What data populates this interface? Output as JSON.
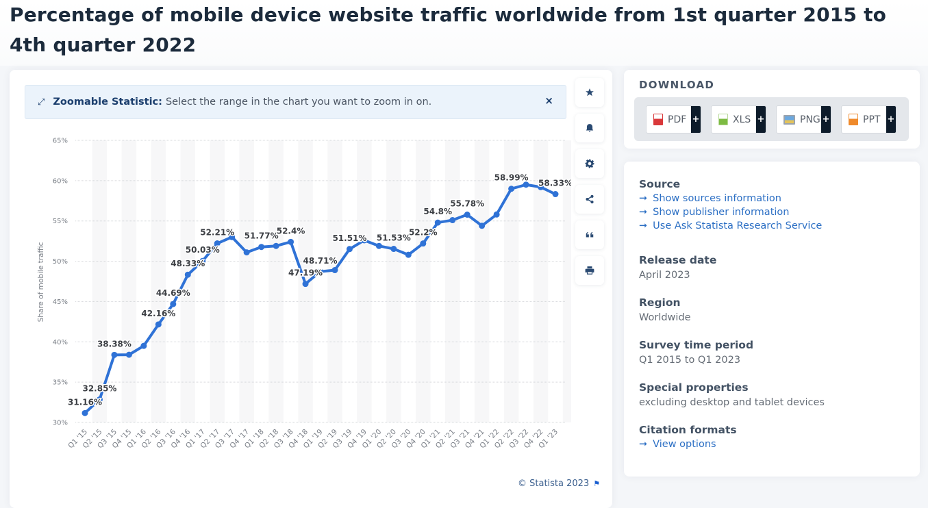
{
  "page": {
    "title": "Percentage of mobile device website traffic worldwide from 1st quarter 2015 to 4th quarter 2022"
  },
  "zoom_banner": {
    "icon": "expand-arrows-icon",
    "label": "Zoomable Statistic:",
    "text": "Select the range in the chart you want to zoom in on.",
    "close": "×"
  },
  "tools": [
    {
      "name": "favorite",
      "icon": "star-icon"
    },
    {
      "name": "notification",
      "icon": "bell-icon"
    },
    {
      "name": "settings",
      "icon": "gear-icon"
    },
    {
      "name": "share",
      "icon": "share-icon"
    },
    {
      "name": "cite",
      "icon": "quote-icon"
    },
    {
      "name": "print",
      "icon": "printer-icon"
    }
  ],
  "copyright": "© Statista 2023",
  "download": {
    "title": "DOWNLOAD",
    "buttons": [
      {
        "label": "PDF",
        "color": "#d9383a"
      },
      {
        "label": "XLS",
        "color": "#7dbb42"
      },
      {
        "label": "PNG",
        "color": "#4f87c6"
      },
      {
        "label": "PPT",
        "color": "#ef8a2b"
      }
    ],
    "plus": "+"
  },
  "info": {
    "source_head": "Source",
    "source_links": [
      "Show sources information",
      "Show publisher information",
      "Use Ask Statista Research Service"
    ],
    "release_head": "Release date",
    "release_val": "April 2023",
    "region_head": "Region",
    "region_val": "Worldwide",
    "survey_head": "Survey time period",
    "survey_val": "Q1 2015 to Q1 2023",
    "special_head": "Special properties",
    "special_val": "excluding desktop and tablet devices",
    "citation_head": "Citation formats",
    "citation_link": "View options",
    "arrow": "➞"
  },
  "chart_data": {
    "type": "line",
    "title": "Percentage of mobile device website traffic worldwide from 1st quarter 2015 to 4th quarter 2022",
    "xlabel": "",
    "ylabel": "Share of mobile traffic",
    "ylim": [
      30,
      65
    ],
    "yticks": [
      30,
      35,
      40,
      45,
      50,
      55,
      60,
      65
    ],
    "ytick_suffix": "%",
    "grid": true,
    "color": "#2f72d6",
    "categories": [
      "Q1 '15",
      "Q2 '15",
      "Q3 '15",
      "Q4 '15",
      "Q1 '16",
      "Q2 '16",
      "Q3 '16",
      "Q4 '16",
      "Q1 '17",
      "Q2 '17",
      "Q3 '17",
      "Q4 '17",
      "Q1 '18",
      "Q2 '18",
      "Q3 '18",
      "Q4 '18",
      "Q1 '19",
      "Q2 '19",
      "Q3 '19",
      "Q4 '19",
      "Q1 '20",
      "Q2 '20",
      "Q3 '20",
      "Q4 '20",
      "Q1 '21",
      "Q2 '21",
      "Q3 '21",
      "Q4 '21",
      "Q1 '22",
      "Q2 '22",
      "Q3 '22",
      "Q4 '22",
      "Q1 '23"
    ],
    "series": [
      {
        "name": "Share of mobile traffic",
        "values": [
          31.16,
          32.85,
          38.38,
          38.4,
          39.5,
          42.16,
          44.69,
          48.33,
          50.03,
          52.21,
          53.0,
          51.1,
          51.77,
          51.9,
          52.4,
          47.19,
          48.71,
          48.9,
          51.51,
          52.6,
          51.9,
          51.53,
          50.8,
          52.2,
          54.8,
          55.1,
          55.78,
          54.4,
          55.8,
          58.99,
          59.5,
          59.2,
          58.33
        ],
        "labels": [
          "31.16%",
          "32.85%",
          "38.38%",
          null,
          null,
          "42.16%",
          "44.69%",
          "48.33%",
          "50.03%",
          "52.21%",
          null,
          null,
          "51.77%",
          null,
          "52.4%",
          "47.19%",
          "48.71%",
          null,
          "51.51%",
          null,
          null,
          "51.53%",
          null,
          "52.2%",
          "54.8%",
          null,
          "55.78%",
          null,
          null,
          "58.99%",
          null,
          null,
          "58.33%"
        ]
      }
    ]
  }
}
